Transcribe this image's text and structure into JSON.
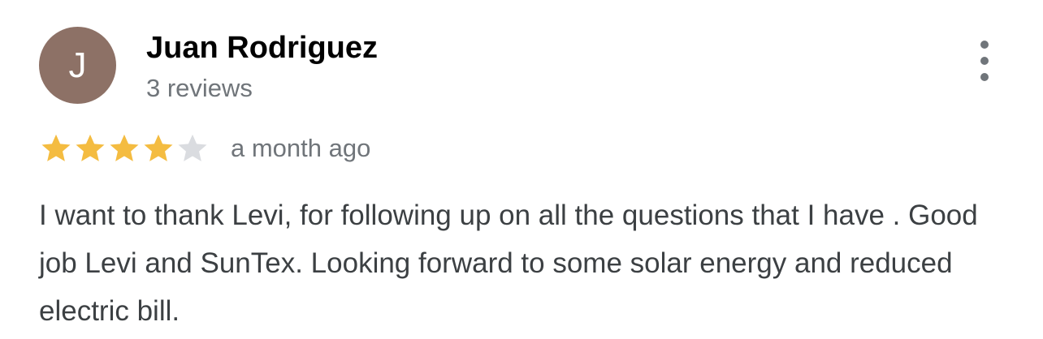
{
  "reviewer": {
    "name": "Juan Rodriguez",
    "review_count": "3 reviews",
    "avatar_initial": "J",
    "avatar_color": "#8d7166"
  },
  "review": {
    "rating": 4,
    "max_rating": 5,
    "time": "a month ago",
    "text": "I want to thank Levi, for following up on all the questions that I have . Good job Levi and SunTex. Looking forward to some solar energy and reduced electric bill."
  },
  "colors": {
    "star_filled": "#f4bc41",
    "star_empty": "#dadce0",
    "secondary_text": "#70757a",
    "body_text": "#3c4043"
  },
  "icons": {
    "menu": "more-vert-icon",
    "star": "star-icon"
  }
}
